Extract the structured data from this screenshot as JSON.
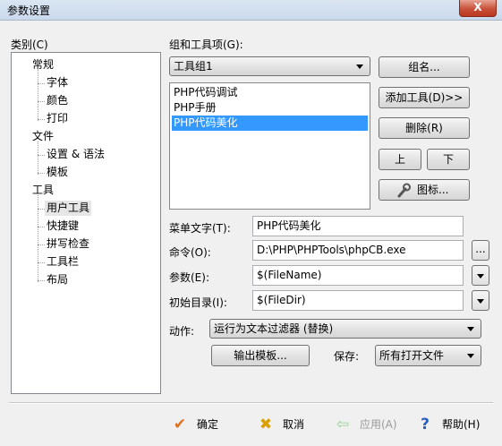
{
  "window": {
    "title": "参数设置",
    "close_label": "X"
  },
  "category": {
    "label": "类别(C)",
    "groups": [
      {
        "label": "常规",
        "children": [
          "字体",
          "颜色",
          "打印"
        ]
      },
      {
        "label": "文件",
        "children": [
          "设置 & 语法",
          "模板"
        ]
      },
      {
        "label": "工具",
        "children": [
          "用户工具",
          "快捷键",
          "拼写检查",
          "工具栏",
          "布局"
        ]
      }
    ]
  },
  "group_tools": {
    "label": "组和工具项(G):",
    "combo_value": "工具组1",
    "items": [
      "PHP代码调试",
      "PHP手册",
      "PHP代码美化"
    ],
    "selected_index": 2
  },
  "side_buttons": {
    "group_name": "组名...",
    "add_tool": "添加工具(D)>>",
    "delete": "删除(R)",
    "up": "上",
    "down": "下",
    "icon": "图标..."
  },
  "fields": {
    "menu_text_label": "菜单文字(T):",
    "menu_text_value": "PHP代码美化",
    "command_label": "命令(O):",
    "command_value": "D:\\PHP\\PHPTools\\phpCB.exe",
    "params_label": "参数(E):",
    "params_value": "$(FileName)",
    "init_dir_label": "初始目录(I):",
    "init_dir_value": "$(FileDir)",
    "browse_label": "...",
    "action_label": "动作:",
    "action_value": "运行为文本过滤器 (替换)",
    "output_template": "输出模板...",
    "save_label": "保存:",
    "save_value": "所有打开文件"
  },
  "footer": {
    "ok": "确定",
    "cancel": "取消",
    "apply": "应用(A)",
    "help": "帮助(H)"
  }
}
